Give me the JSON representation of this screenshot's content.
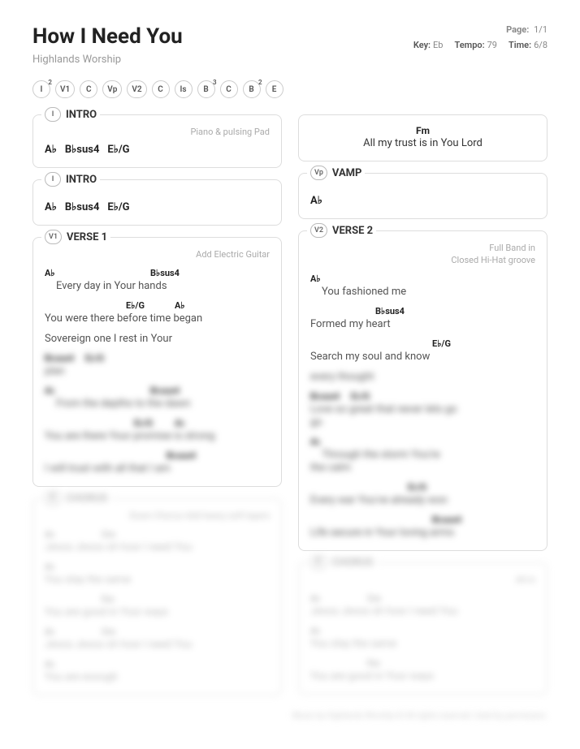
{
  "header": {
    "title": "How I Need You",
    "artist": "Highlands Worship",
    "page_label": "Page:",
    "page_value": "1/1",
    "key_label": "Key:",
    "key_value": "Eb",
    "tempo_label": "Tempo:",
    "tempo_value": "79",
    "time_label": "Time:",
    "time_value": "6/8"
  },
  "nav": [
    {
      "label": "I",
      "sup": "2"
    },
    {
      "label": "V1",
      "sup": ""
    },
    {
      "label": "C",
      "sup": ""
    },
    {
      "label": "Vp",
      "sup": ""
    },
    {
      "label": "V2",
      "sup": ""
    },
    {
      "label": "C",
      "sup": ""
    },
    {
      "label": "Is",
      "sup": ""
    },
    {
      "label": "B",
      "sup": "3"
    },
    {
      "label": "C",
      "sup": ""
    },
    {
      "label": "B",
      "sup": "2"
    },
    {
      "label": "E",
      "sup": ""
    }
  ],
  "left": {
    "intro1": {
      "badge": "I",
      "title": "INTRO",
      "note": "Piano & pulsing Pad",
      "chords": [
        "A♭",
        "B♭sus4",
        "E♭/G"
      ]
    },
    "intro2": {
      "badge": "I",
      "title": "INTRO",
      "chords": [
        "A♭",
        "B♭sus4",
        "E♭/G"
      ]
    },
    "verse1": {
      "badge": "V1",
      "title": "VERSE 1",
      "note": "Add Electric Guitar",
      "l1_c1": "A♭",
      "l1_c2": "B♭sus4",
      "l1": "Every day in Your hands",
      "l2_c1": "E♭/G",
      "l2_c2": "A♭",
      "l2": "You were there before   time began",
      "l3": "Sovereign one I rest in Your",
      "b1": "plan",
      "b2": "From the depths to the dawn",
      "b3": "You are there Your promise is strong",
      "b4": "I will trust with all that I am"
    },
    "chorus1": {
      "badge": "C",
      "title": "CHORUS",
      "note": "Down Chorus Add heavy soft layers",
      "b1": "Jesus Jesus oh how I need You",
      "b2": "You stay the same",
      "b3": "You are good in Your ways",
      "b4": "Jesus Jesus oh how I need You",
      "b5": "You are enough"
    }
  },
  "right": {
    "fragment": {
      "chord": "Fm",
      "lyric": "All my trust  is in You Lord"
    },
    "vamp": {
      "badge": "Vp",
      "title": "VAMP",
      "chord": "A♭"
    },
    "verse2": {
      "badge": "V2",
      "title": "VERSE 2",
      "note1": "Full Band in",
      "note2": "Closed Hi-Hat groove",
      "l1_c1": "A♭",
      "l1": "You fashioned me",
      "l2_c1": "B♭sus4",
      "l2": "Formed my heart",
      "l3_c1": "E♭/G",
      "l3": "Search my soul and know",
      "b1": "every thought",
      "b2": "Love so great that never lets go",
      "b3": "Through the storm You're",
      "b4": "the calm",
      "b5": "Every war You've already won",
      "b6": "Life secure in Your loving arms"
    },
    "chorus2": {
      "badge": "C",
      "title": "CHORUS",
      "note": "All in",
      "b1": "Jesus Jesus oh how I need You",
      "b2": "You stay the same",
      "b3": "You are good in Your ways"
    }
  },
  "footer": "Music by Highlands Worship © All rights reserved. Used by permission."
}
